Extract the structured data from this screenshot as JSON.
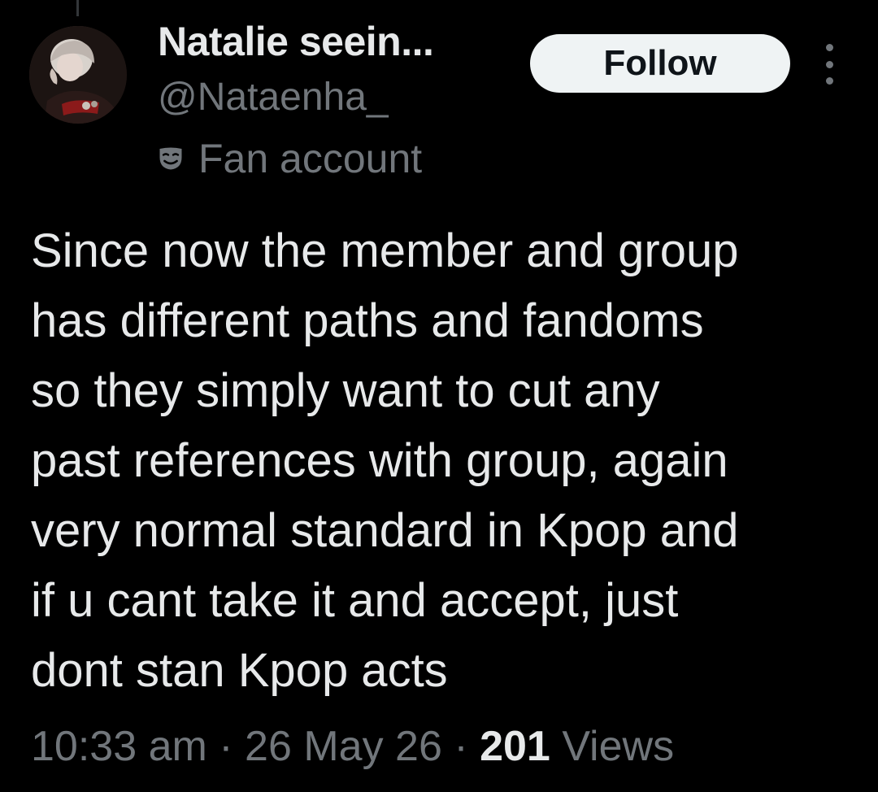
{
  "author": {
    "display_name": "Natalie seein...",
    "handle": "@Nataenha_",
    "label_icon": "theater-mask-icon",
    "label_text": "Fan account",
    "avatar_icon": "profile-photo-avatar"
  },
  "actions": {
    "follow_label": "Follow",
    "more_icon": "more-vertical-icon"
  },
  "tweet": {
    "text": "Since now the member and group\nhas different paths and fandoms\nso they simply want to cut any\npast references with group, again\nvery normal standard in Kpop and\nif u cant take it and accept, just\ndont stan Kpop acts"
  },
  "meta": {
    "time": "10:33 am",
    "separator": "·",
    "date": "26 May 26",
    "views_count": "201",
    "views_label": "Views"
  },
  "colors": {
    "background": "#000000",
    "primary_text": "#e7e9ea",
    "secondary_text": "#71767b",
    "follow_button_bg": "#eff3f4",
    "follow_button_text": "#0f1419"
  }
}
